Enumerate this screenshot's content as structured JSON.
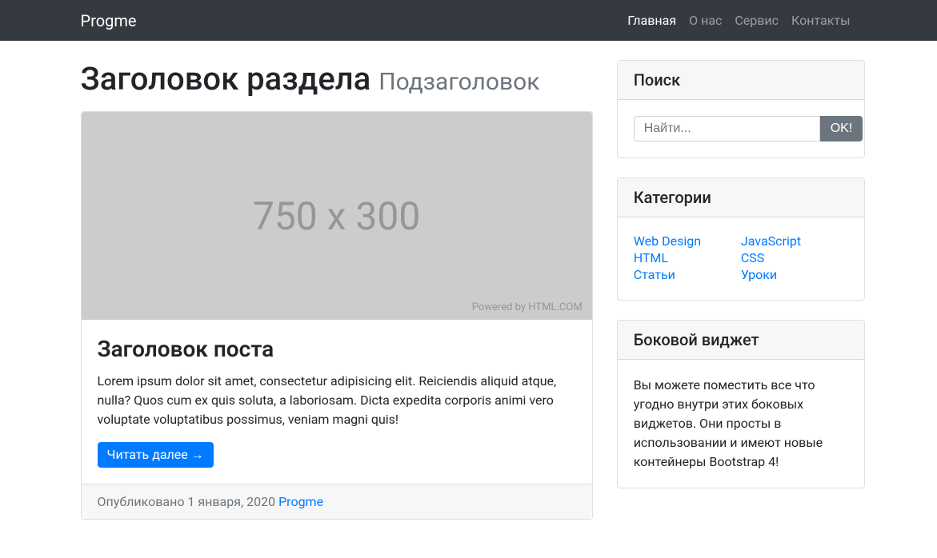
{
  "nav": {
    "brand": "Progme",
    "items": [
      {
        "label": "Главная",
        "active": true
      },
      {
        "label": "О нас",
        "active": false
      },
      {
        "label": "Сервис",
        "active": false
      },
      {
        "label": "Контакты",
        "active": false
      }
    ]
  },
  "heading": {
    "title": "Заголовок раздела",
    "subtitle": "Подзаголовок"
  },
  "post": {
    "image_placeholder": "750 x 300",
    "image_credit": "Powered by HTML.COM",
    "title": "Заголовок поста",
    "text": "Lorem ipsum dolor sit amet, consectetur adipisicing elit. Reiciendis aliquid atque, nulla? Quos cum ex quis soluta, a laboriosam. Dicta expedita corporis animi vero voluptate voluptatibus possimus, veniam magni quis!",
    "read_more": "Читать далее →",
    "footer_prefix": "Опубликовано 1 января, 2020 ",
    "footer_author": "Progme"
  },
  "sidebar": {
    "search": {
      "header": "Поиск",
      "placeholder": "Найти...",
      "button": "OK!"
    },
    "categories": {
      "header": "Категории",
      "left": [
        "Web Design",
        "HTML",
        "Статьи"
      ],
      "right": [
        "JavaScript",
        "CSS",
        "Уроки"
      ]
    },
    "widget": {
      "header": "Боковой виджет",
      "text": "Вы можете поместить все что угодно внутри этих боковых виджетов. Они просты в использовании и имеют новые контейнеры Bootstrap 4!"
    }
  }
}
